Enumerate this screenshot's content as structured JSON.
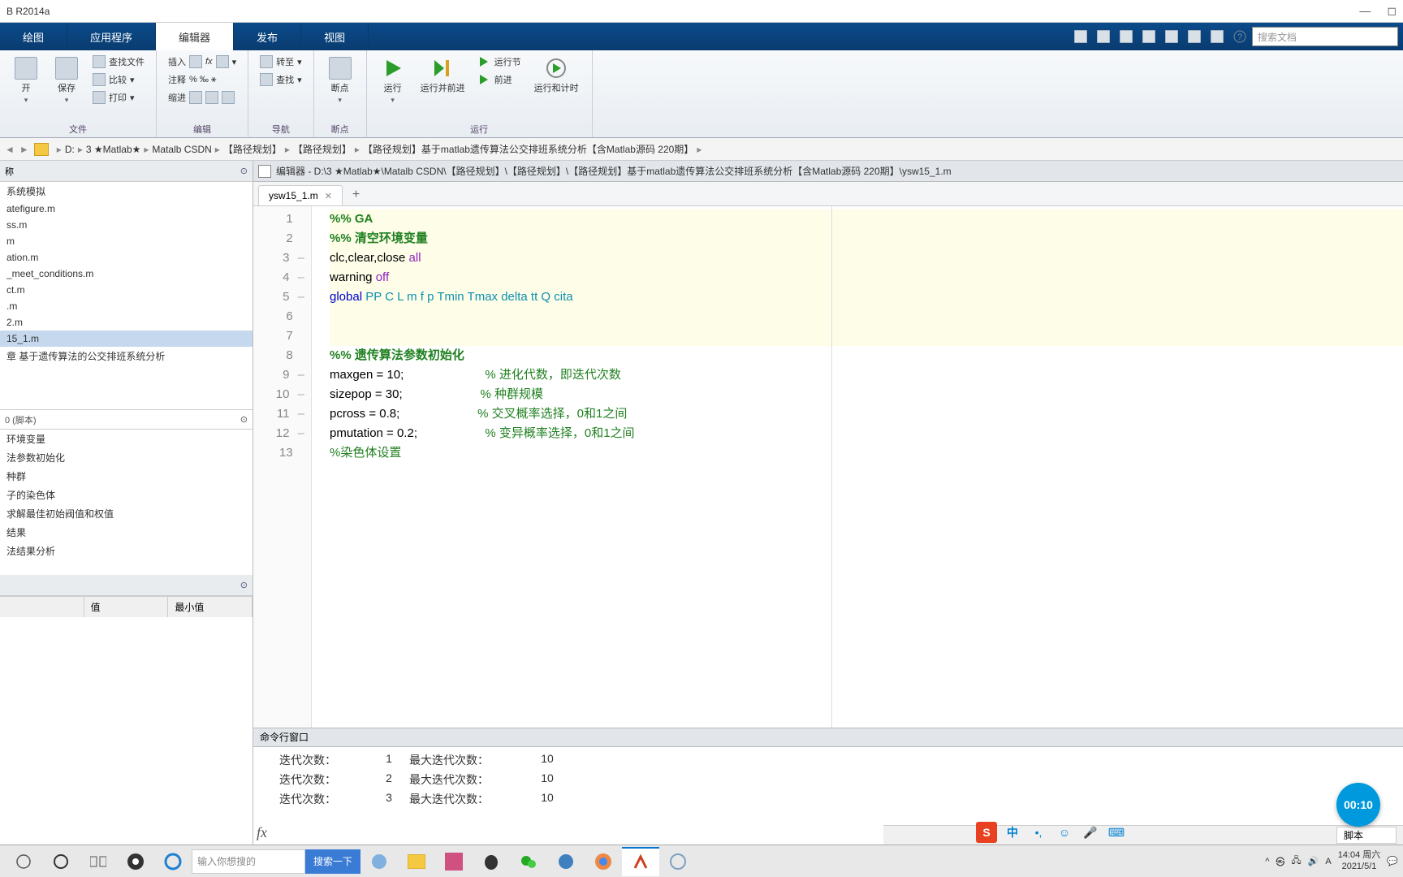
{
  "titlebar": {
    "title": "B R2014a"
  },
  "tabs": {
    "items": [
      "绘图",
      "应用程序",
      "编辑器",
      "发布",
      "视图"
    ],
    "active_index": 2,
    "search_placeholder": "搜索文档"
  },
  "ribbon": {
    "groups": [
      {
        "label": "文件",
        "big": [
          {
            "label": "开"
          },
          {
            "label": "保存"
          }
        ],
        "small": [
          {
            "label": "查找文件"
          },
          {
            "label": "比较"
          },
          {
            "label": "打印"
          }
        ]
      },
      {
        "label": "编辑",
        "small_cols": [
          [
            {
              "label": "插入"
            },
            {
              "label": "注释"
            },
            {
              "label": "缩进"
            }
          ],
          [
            {
              "label": "fx"
            },
            {
              "label": "%"
            },
            {
              "label": ""
            }
          ]
        ]
      },
      {
        "label": "导航",
        "big": [],
        "small": [
          {
            "label": "转至"
          },
          {
            "label": "查找"
          }
        ]
      },
      {
        "label": "断点",
        "big": [
          {
            "label": "断点"
          }
        ]
      },
      {
        "label": "运行",
        "big": [
          {
            "label": "运行"
          },
          {
            "label": "运行并前进"
          },
          {
            "label": "运行节"
          },
          {
            "label": "前进"
          },
          {
            "label": "运行和计时"
          }
        ]
      }
    ]
  },
  "path": {
    "segments": [
      "D:",
      "3 ★Matlab★",
      "Matalb CSDN",
      "【路径规划】",
      "【路径规划】",
      "【路径规划】基于matlab遗传算法公交排班系统分析【含Matlab源码 220期】"
    ]
  },
  "left_panel": {
    "header": "称",
    "files": [
      "系统模拟",
      "atefigure.m",
      "ss.m",
      "m",
      "ation.m",
      "_meet_conditions.m",
      "ct.m",
      ".m",
      "2.m",
      "15_1.m",
      "章  基于遗传算法的公交排班系统分析"
    ],
    "selected_index": 9,
    "dropdown": "0 (脚本)",
    "sections": [
      "环境变量",
      "法参数初始化",
      "种群",
      "子的染色体",
      "求解最佳初始阀值和权值",
      "结果",
      "法结果分析"
    ],
    "var_cols": [
      "",
      "值",
      "最小值"
    ]
  },
  "editor": {
    "title_prefix": "编辑器 - ",
    "title_path": "D:\\3 ★Matlab★\\Matalb CSDN\\【路径规划】\\【路径规划】\\【路径规划】基于matlab遗传算法公交排班系统分析【含Matlab源码 220期】\\ysw15_1.m",
    "tab_name": "ysw15_1.m",
    "lines": [
      {
        "n": 1,
        "dash": "",
        "cls": "sec-bg",
        "html": "<span class='k-comment'>%% GA</span>"
      },
      {
        "n": 2,
        "dash": "",
        "cls": "sec-bg",
        "html": "<span class='k-comment'>%% 清空环境变量</span>"
      },
      {
        "n": 3,
        "dash": "–",
        "cls": "sec-bg",
        "html": "clc,clear,close <span class='k-string'>all</span>"
      },
      {
        "n": 4,
        "dash": "–",
        "cls": "sec-bg",
        "html": "warning <span class='k-string'>off</span>"
      },
      {
        "n": 5,
        "dash": "–",
        "cls": "sec-bg",
        "html": "<span class='k-keyword'>global</span> <span class='k-ident'>PP C L m f p Tmin Tmax delta tt Q cita</span>"
      },
      {
        "n": 6,
        "dash": "",
        "cls": "sec-bg",
        "html": ""
      },
      {
        "n": 7,
        "dash": "",
        "cls": "sec-bg",
        "html": ""
      },
      {
        "n": 8,
        "dash": "",
        "cls": "",
        "html": "<span class='k-comment'>%% 遗传算法参数初始化</span>"
      },
      {
        "n": 9,
        "dash": "–",
        "cls": "",
        "html": "maxgen = 10;                        <span class='k-comment-n'>% 进化代数，即迭代次数</span>"
      },
      {
        "n": 10,
        "dash": "–",
        "cls": "",
        "html": "sizepop = 30;                       <span class='k-comment-n'>% 种群规模</span>"
      },
      {
        "n": 11,
        "dash": "–",
        "cls": "",
        "html": "pcross = 0.8;                       <span class='k-comment-n'>% 交叉概率选择，0和1之间</span>"
      },
      {
        "n": 12,
        "dash": "–",
        "cls": "",
        "html": "pmutation = 0.2;                    <span class='k-comment-n'>% 变异概率选择，0和1之间</span>"
      },
      {
        "n": 13,
        "dash": "",
        "cls": "",
        "html": "<span class='k-comment-n'>%染色体设置</span>"
      }
    ]
  },
  "cmd": {
    "title": "命令行窗口",
    "rows": [
      {
        "a": "迭代次数：",
        "b": "1",
        "c": "最大迭代次数：",
        "d": "10"
      },
      {
        "a": "迭代次数：",
        "b": "2",
        "c": "最大迭代次数：",
        "d": "10"
      },
      {
        "a": "迭代次数：",
        "b": "3",
        "c": "最大迭代次数：",
        "d": "10"
      }
    ]
  },
  "status": {
    "script": "脚本"
  },
  "timer": "00:10",
  "ime": {
    "s": "S",
    "zh": "中"
  },
  "taskbar": {
    "search_placeholder": "输入你想搜的",
    "search_btn": "搜索一下",
    "time": "14:04 周六",
    "date": "2021/5/1"
  }
}
